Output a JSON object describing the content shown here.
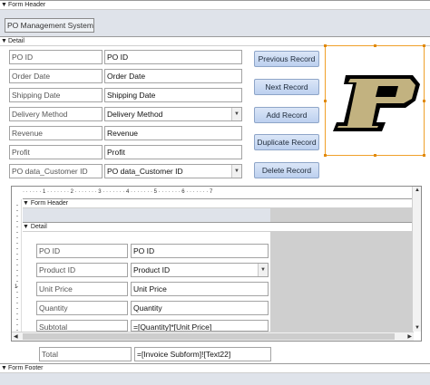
{
  "sections": {
    "form_header": "Form Header",
    "detail": "Detail",
    "form_footer": "Form Footer"
  },
  "header": {
    "title": "PO Management System"
  },
  "fields": [
    {
      "label": "PO ID",
      "value": "PO ID",
      "combo": false
    },
    {
      "label": "Order Date",
      "value": "Order Date",
      "combo": false
    },
    {
      "label": "Shipping Date",
      "value": "Shipping Date",
      "combo": false
    },
    {
      "label": "Delivery Method",
      "value": "Delivery Method",
      "combo": true
    },
    {
      "label": "Revenue",
      "value": "Revenue",
      "combo": false
    },
    {
      "label": "Profit",
      "value": "Profit",
      "combo": false
    },
    {
      "label": "PO data_Customer ID",
      "value": "PO data_Customer ID",
      "combo": true
    }
  ],
  "buttons": {
    "previous": "Previous Record",
    "next": "Next Record",
    "add": "Add Record",
    "duplicate": "Duplicate Record",
    "delete": "Delete Record"
  },
  "logo": {
    "letter": "P",
    "color_gold": "#c2b280",
    "color_black": "#000000"
  },
  "subform": {
    "ruler_top": "· · · · · · 1 · · · · · · · 2 · · · · · · · 3 · · · · · · · 4 · · · · · · · 5 · · · · · · · 6 · · · · · · · 7",
    "form_header": "Form Header",
    "detail": "Detail",
    "fields": [
      {
        "label": "PO ID",
        "value": "PO ID",
        "combo": false
      },
      {
        "label": "Product ID",
        "value": "Product ID",
        "combo": true
      },
      {
        "label": "Unit Price",
        "value": "Unit Price",
        "combo": false
      },
      {
        "label": "Quantity",
        "value": "Quantity",
        "combo": false
      },
      {
        "label": "Subtotal",
        "value": "=[Quantity]*[Unit Price]",
        "combo": false
      }
    ]
  },
  "total": {
    "label": "Total",
    "value": "=[Invoice Subform]![Text22]"
  },
  "colors": {
    "section_bg": "#dfe3ea",
    "button": "#bcd0ef",
    "selection": "#f0a02a"
  }
}
